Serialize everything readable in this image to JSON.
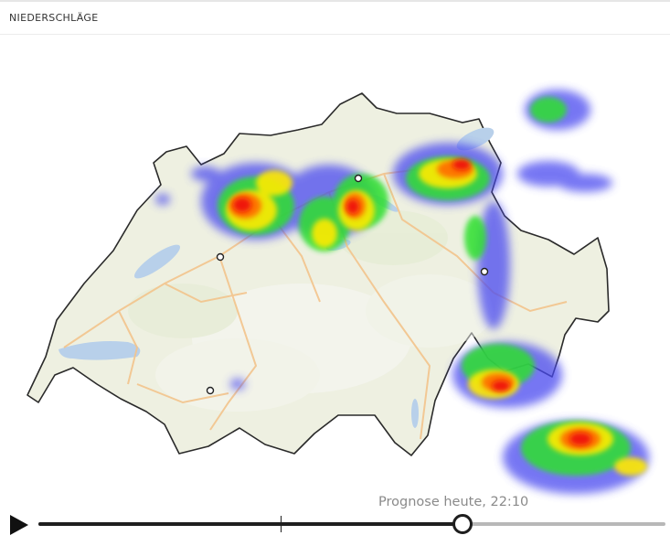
{
  "panel": {
    "title": "NIEDERSCHLÄGE"
  },
  "timeline": {
    "label": "Prognose heute, 22:10",
    "progress": 0.675,
    "now_marker": 0.386
  },
  "icons": {
    "play": "play-icon"
  },
  "colors": {
    "precip_light": "#4a4af0",
    "precip_moderate": "#2ee02e",
    "precip_heavy": "#ffea00",
    "precip_intense": "#ff6a00",
    "precip_extreme": "#ee1111",
    "track_active": "#1e1e1e",
    "track_inactive": "#b8b8b8"
  }
}
